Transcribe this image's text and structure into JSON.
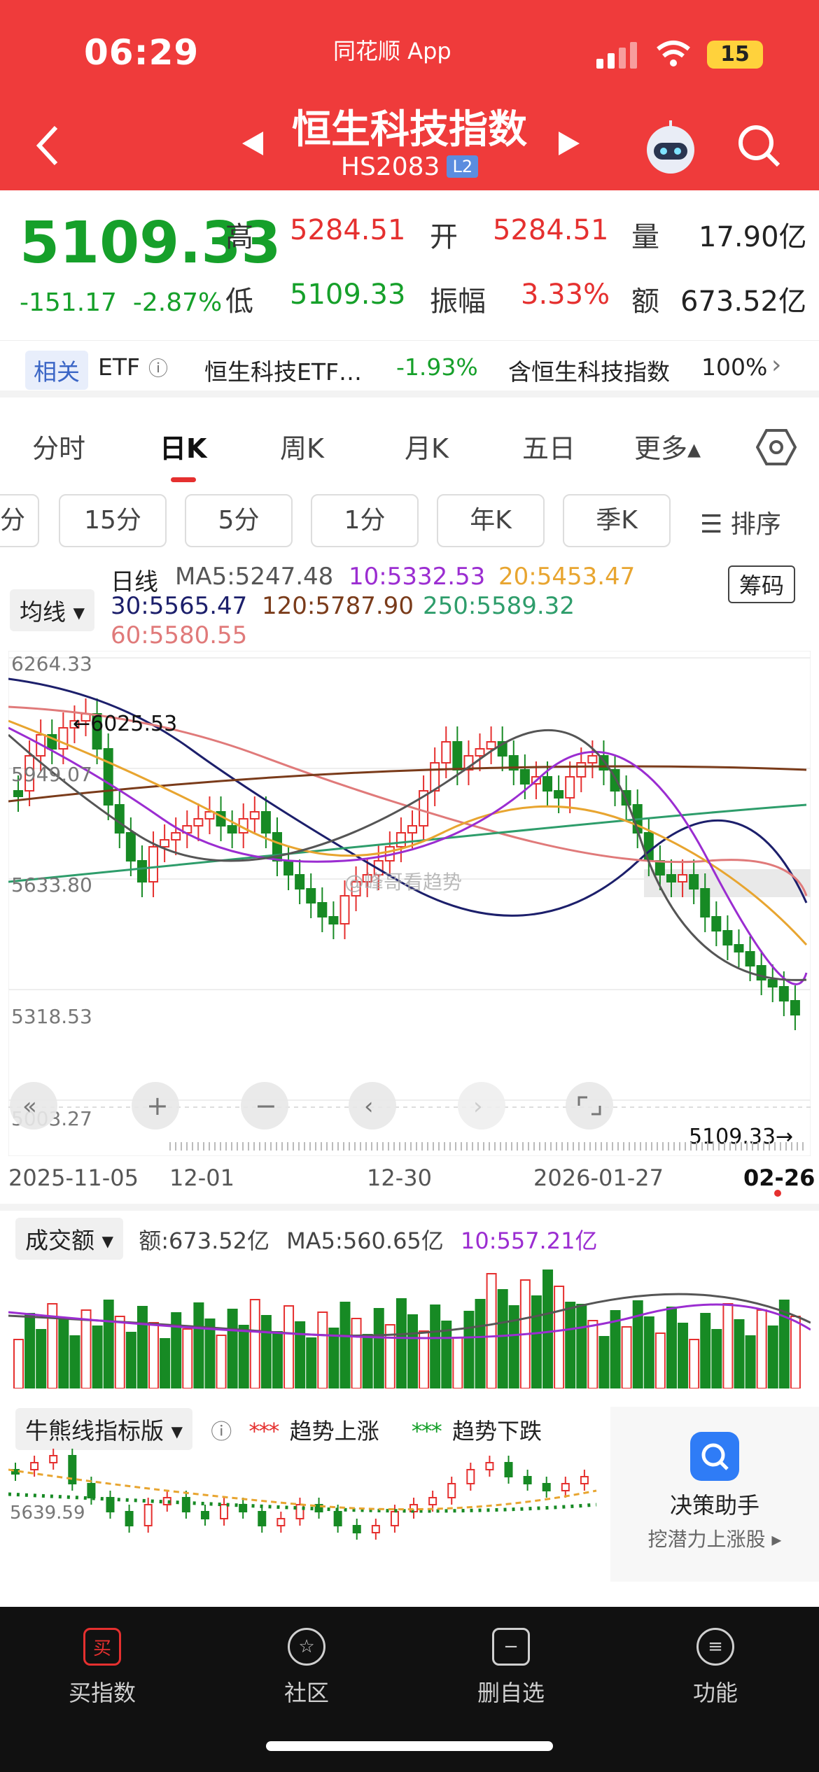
{
  "status": {
    "time": "06:29",
    "carrier": "同花顺 App",
    "battery": "15"
  },
  "header": {
    "title": "恒生科技指数",
    "code": "HS2083",
    "level": "L2"
  },
  "quote": {
    "price": "5109.33",
    "change": "-151.17",
    "change_pct": "-2.87%",
    "high_label": "高",
    "high": "5284.51",
    "open_label": "开",
    "open": "5284.51",
    "volume_label": "量",
    "volume": "17.90亿",
    "low_label": "低",
    "low": "5109.33",
    "amplitude_label": "振幅",
    "amplitude": "3.33%",
    "amount_label": "额",
    "amount": "673.52亿"
  },
  "related": {
    "tag": "相关",
    "etf_label": "ETF",
    "etf_name": "恒生科技ETF…",
    "etf_change": "-1.93%",
    "contains": "含恒生科技指数",
    "contains_pct": "100%"
  },
  "tabs": [
    {
      "label": "分时"
    },
    {
      "label": "日K"
    },
    {
      "label": "周K"
    },
    {
      "label": "月K"
    },
    {
      "label": "五日"
    },
    {
      "label": "更多▴"
    }
  ],
  "subtabs": [
    {
      "label": "分"
    },
    {
      "label": "15分"
    },
    {
      "label": "5分"
    },
    {
      "label": "1分"
    },
    {
      "label": "年K"
    },
    {
      "label": "季K"
    },
    {
      "label": "☰ 排序"
    }
  ],
  "ma_legend": {
    "select": "均线",
    "period": "日线",
    "ma5": "MA5:5247.48",
    "ma10": "10:5332.53",
    "ma20": "20:5453.47",
    "ma30": "30:5565.47",
    "ma120": "120:5787.90",
    "ma250": "250:5589.32",
    "ma60": "60:5580.55",
    "chip_button": "筹码"
  },
  "chart": {
    "y_labels": [
      "6264.33",
      "5949.07",
      "5633.80",
      "5318.53",
      "5003.27"
    ],
    "x_labels": [
      "2025-11-05",
      "12-01",
      "12-30",
      "2026-01-27",
      "02-26"
    ],
    "high_mark": "←6025.53",
    "last_mark": "5109.33→",
    "watermark": "@峰哥看趋势",
    "colors": {
      "up": "#e5302f",
      "down": "#178a24",
      "ma5": "#555555",
      "ma10": "#9b2dd1",
      "ma20": "#e8a530",
      "ma30": "#1c1f6b",
      "ma60": "#e07a7a",
      "ma120": "#7a3b1a",
      "ma250": "#2e9d6b"
    },
    "series_colors_hex": [
      "#555555",
      "#9b2dd1",
      "#e8a530",
      "#1c1f6b",
      "#7a3b1a",
      "#2e9d6b",
      "#e07a7a"
    ]
  },
  "volume": {
    "select": "成交额",
    "amount": "额:673.52亿",
    "ma5": "MA5:560.65亿",
    "ma10": "10:557.21亿"
  },
  "bull": {
    "select": "牛熊线指标版",
    "up_label": "趋势上涨",
    "down_label": "趋势下跌",
    "y_label": "5639.59",
    "assist_title": "决策助手",
    "assist_sub": "挖潜力上涨股 ▸"
  },
  "nav": [
    {
      "label": "买指数",
      "icon": "买"
    },
    {
      "label": "社区",
      "icon": "☆"
    },
    {
      "label": "删自选",
      "icon": "−"
    },
    {
      "label": "功能",
      "icon": "≡"
    }
  ]
}
